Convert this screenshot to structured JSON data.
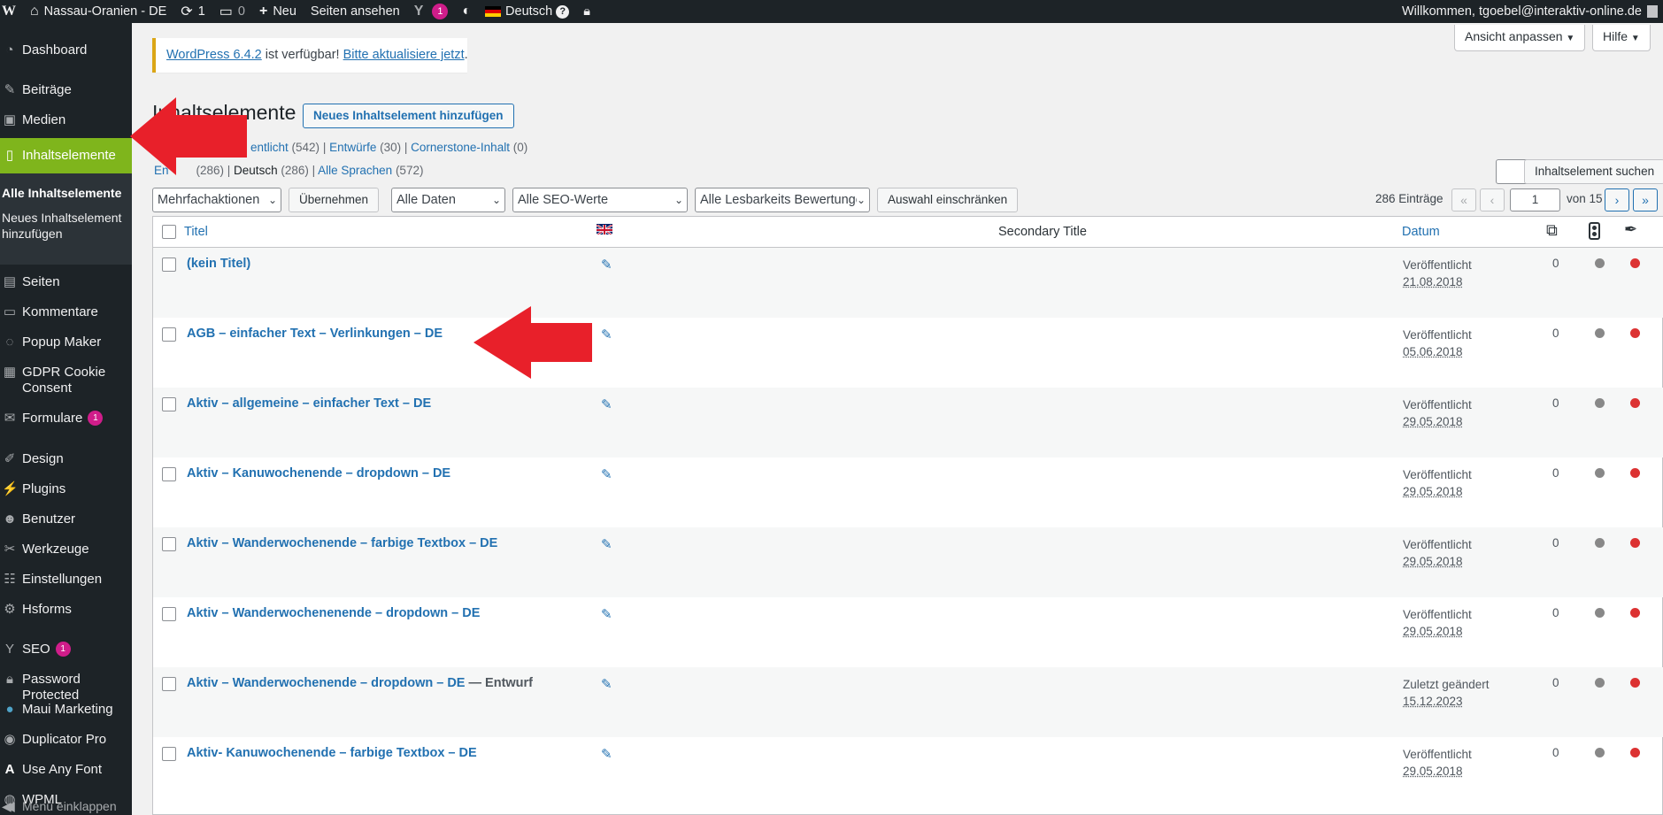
{
  "adminbar": {
    "wp_logo": "W",
    "site_name": "Nassau-Oranien - DE",
    "updates_count": "1",
    "comments_count": "0",
    "new_label": "Neu",
    "view_pages_label": "Seiten ansehen",
    "yoast_count": "1",
    "language_label": "Deutsch",
    "help_glyph": "?",
    "welcome_text": "Willkommen, tgoebel@interaktiv-online.de"
  },
  "sidebar": {
    "dashboard": "Dashboard",
    "posts": "Beiträge",
    "media": "Medien",
    "content_elements": "Inhaltselemente",
    "sub_all": "Alle Inhaltselemente",
    "sub_new_1": "Neues Inhaltselement",
    "sub_new_2": "hinzufügen",
    "pages": "Seiten",
    "comments": "Kommentare",
    "popup_maker": "Popup Maker",
    "gdpr_1": "GDPR Cookie",
    "gdpr_2": "Consent",
    "forms": "Formulare",
    "forms_count": "1",
    "design": "Design",
    "plugins": "Plugins",
    "users": "Benutzer",
    "tools": "Werkzeuge",
    "settings": "Einstellungen",
    "hsforms": "Hsforms",
    "seo": "SEO",
    "seo_count": "1",
    "password_protected": "Password Protected",
    "maui": "Maui Marketing",
    "duplicator": "Duplicator Pro",
    "use_any_font": "Use Any Font",
    "wpml": "WPML",
    "collapse": "Menü einklappen"
  },
  "top_buttons": {
    "screen_options": "Ansicht anpassen",
    "help": "Hilfe"
  },
  "notice": {
    "version_link": "WordPress 6.4.2",
    "middle": " ist verfügbar! ",
    "update_link": "Bitte aktualisiere jetzt",
    "end": "."
  },
  "page": {
    "title": "Inhaltselemente",
    "add_new": "Neues Inhaltselement hinzufügen"
  },
  "status_links": {
    "published": "entlicht",
    "published_count": " (542)",
    "sep1": " | ",
    "drafts": "Entwürfe",
    "drafts_count": " (30)",
    "sep2": " | ",
    "cornerstone": "Cornerstone-Inhalt",
    "cornerstone_count": " (0)"
  },
  "lang_links": {
    "all_partial": "En",
    "all_partial_count": "(286)",
    "sep1": " | ",
    "german": "Deutsch",
    "german_count": " (286)",
    "sep2": " | ",
    "all_languages": "Alle Sprachen",
    "all_languages_count": " (572)"
  },
  "search": {
    "button": "Inhaltselement suchen"
  },
  "filters": {
    "bulk": "Mehrfachaktionen",
    "apply": "Übernehmen",
    "dates": "Alle Daten",
    "seo": "Alle SEO-Werte",
    "readability": "Alle Lesbarkeits Bewertunge",
    "filter_btn": "Auswahl einschränken"
  },
  "pagination": {
    "items": "286 Einträge",
    "first": "«",
    "prev": "‹",
    "current": "1",
    "of": "von 15",
    "next": "›",
    "last": "»"
  },
  "table": {
    "col_title": "Titel",
    "col_secondary": "Secondary Title",
    "col_date": "Datum",
    "rows": [
      {
        "title": "(kein Titel)",
        "suffix": "",
        "status": "Veröffentlicht",
        "date": "21.08.2018",
        "count": "0"
      },
      {
        "title": "AGB – einfacher Text – Verlinkungen – DE",
        "suffix": "",
        "status": "Veröffentlicht",
        "date": "05.06.2018",
        "count": "0"
      },
      {
        "title": "Aktiv – allgemeine – einfacher Text – DE",
        "suffix": "",
        "status": "Veröffentlicht",
        "date": "29.05.2018",
        "count": "0"
      },
      {
        "title": "Aktiv – Kanuwochenende – dropdown – DE",
        "suffix": "",
        "status": "Veröffentlicht",
        "date": "29.05.2018",
        "count": "0"
      },
      {
        "title": "Aktiv – Wanderwochenende – farbige Textbox – DE",
        "suffix": "",
        "status": "Veröffentlicht",
        "date": "29.05.2018",
        "count": "0"
      },
      {
        "title": "Aktiv – Wanderwochenenende – dropdown – DE",
        "suffix": "",
        "status": "Veröffentlicht",
        "date": "29.05.2018",
        "count": "0"
      },
      {
        "title": "Aktiv – Wanderwochenende – dropdown – DE",
        "suffix": " — Entwurf",
        "status": "Zuletzt geändert",
        "date": "15.12.2023",
        "count": "0"
      },
      {
        "title": "Aktiv- Kanuwochenende – farbige Textbox – DE",
        "suffix": "",
        "status": "Veröffentlicht",
        "date": "29.05.2018",
        "count": "0"
      }
    ]
  },
  "colors": {
    "adminbar_bg": "#1d2327",
    "active_menu": "#7fb51c",
    "link": "#2271b1",
    "annotation_arrow": "#e8202a"
  }
}
